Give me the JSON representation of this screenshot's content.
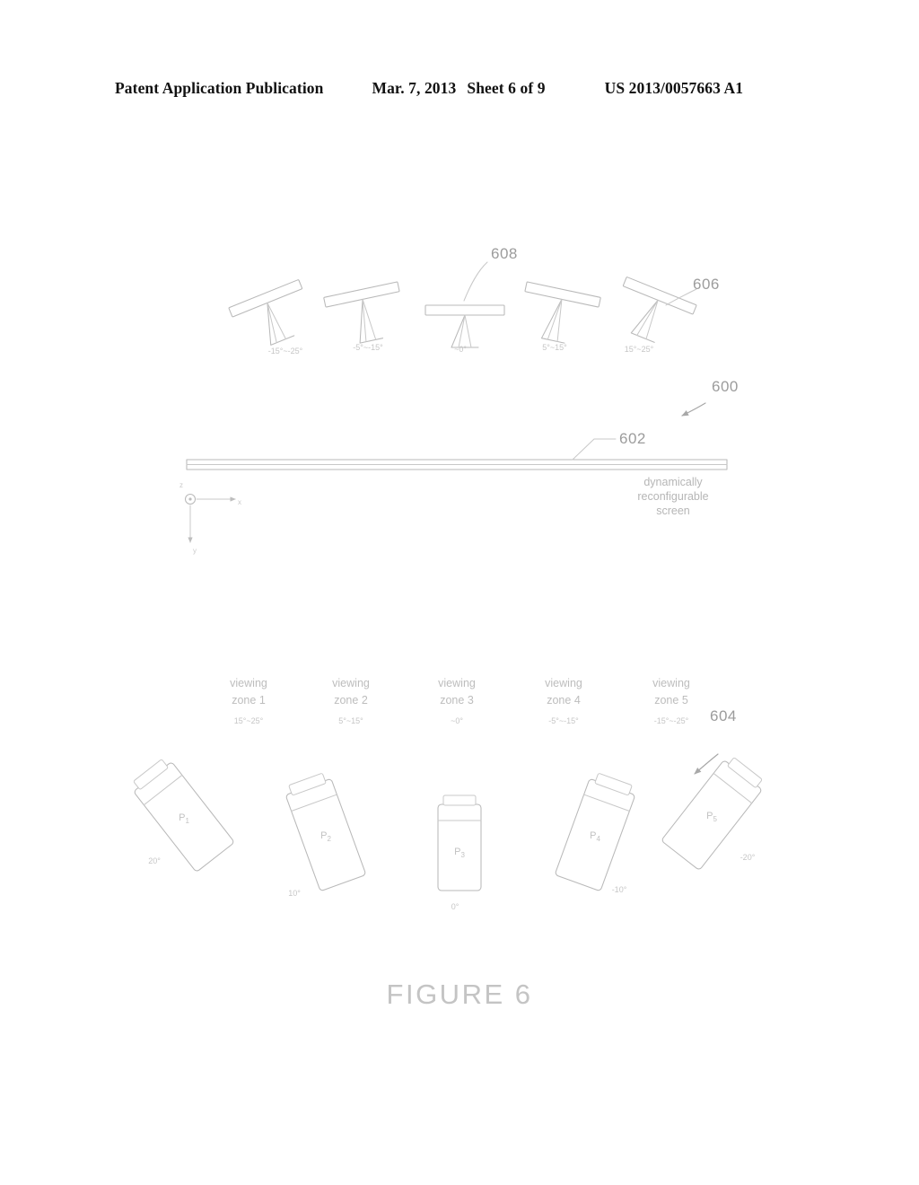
{
  "header": {
    "publication": "Patent Application Publication",
    "date": "Mar. 7, 2013",
    "sheet": "Sheet 6 of 9",
    "doc_number": "US 2013/0057663 A1"
  },
  "figure": {
    "caption": "FIGURE 6",
    "system_ref": "600",
    "screen_ref": "602",
    "screen_label_line1": "dynamically",
    "screen_label_line2": "reconfigurable",
    "screen_label_line3": "screen",
    "devices_ref": "604",
    "projector_ref": "606",
    "projector_array_ref": "608"
  },
  "axes": {
    "x_label": "x",
    "y_label": "y",
    "z_label": "z"
  },
  "projectors": [
    {
      "name": "projector-1",
      "angle_label": "-15°~-25°",
      "rotation": -22
    },
    {
      "name": "projector-2",
      "angle_label": "-5°~-15°",
      "rotation": -12
    },
    {
      "name": "projector-3",
      "angle_label": "~0°",
      "rotation": 0
    },
    {
      "name": "projector-4",
      "angle_label": "5°~15°",
      "rotation": 12
    },
    {
      "name": "projector-5",
      "angle_label": "15°~25°",
      "rotation": 22
    }
  ],
  "viewing_zones": [
    {
      "name": "viewing-zone-1",
      "line1": "viewing",
      "line2": "zone 1",
      "range": "15°~25°"
    },
    {
      "name": "viewing-zone-2",
      "line1": "viewing",
      "line2": "zone 2",
      "range": "5°~15°"
    },
    {
      "name": "viewing-zone-3",
      "line1": "viewing",
      "line2": "zone 3",
      "range": "~0°"
    },
    {
      "name": "viewing-zone-4",
      "line1": "viewing",
      "line2": "zone 4",
      "range": "-5°~-15°"
    },
    {
      "name": "viewing-zone-5",
      "line1": "viewing",
      "line2": "zone 5",
      "range": "-15°~-25°"
    }
  ],
  "devices": [
    {
      "name": "device-p1",
      "label": "P",
      "sub": "1",
      "angle_label": "20°",
      "rotation": -38
    },
    {
      "name": "device-p2",
      "label": "P",
      "sub": "2",
      "angle_label": "10°",
      "rotation": -20
    },
    {
      "name": "device-p3",
      "label": "P",
      "sub": "3",
      "angle_label": "0°",
      "rotation": 0
    },
    {
      "name": "device-p4",
      "label": "P",
      "sub": "4",
      "angle_label": "-10°",
      "rotation": 20
    },
    {
      "name": "device-p5",
      "label": "P",
      "sub": "5",
      "angle_label": "-20°",
      "rotation": 38
    }
  ],
  "colors": {
    "ink": "#111111",
    "line": "#b9b9b9",
    "faint_text": "#c2c2c2"
  }
}
